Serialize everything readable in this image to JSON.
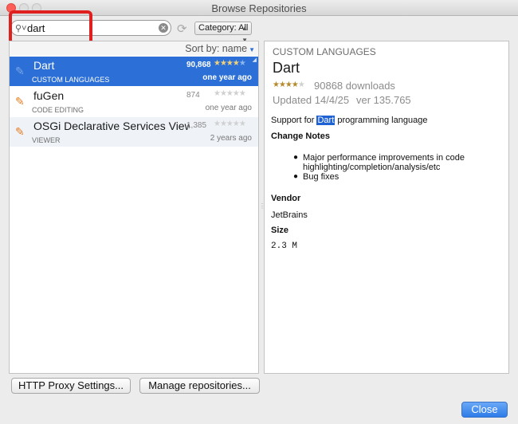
{
  "window": {
    "title": "Browse Repositories"
  },
  "search": {
    "value": "dart",
    "icon": "search-icon"
  },
  "toolbar": {
    "category_label": "Category: All"
  },
  "list": {
    "sort_label": "Sort by: name",
    "plugins": [
      {
        "name": "Dart",
        "category": "CUSTOM LANGUAGES",
        "downloads": "90,868",
        "rating": 4,
        "date": "one year ago",
        "selected": true
      },
      {
        "name": "fuGen",
        "category": "CODE EDITING",
        "downloads": "874",
        "rating": 0,
        "date": "one year ago",
        "selected": false
      },
      {
        "name": "OSGi Declarative Services Viewer",
        "category": "VIEWER",
        "downloads": "1,385",
        "rating": 0,
        "date": "2 years ago",
        "selected": false
      }
    ]
  },
  "detail": {
    "category": "CUSTOM LANGUAGES",
    "name": "Dart",
    "rating": 4,
    "downloads": "90868 downloads",
    "updated": "Updated 14/4/25",
    "version": "ver 135.765",
    "description_pre": "Support for ",
    "description_highlight": "Dart",
    "description_post": " programming language",
    "change_notes_heading": "Change Notes",
    "change_notes": [
      "Major performance improvements in code highlighting/completion/analysis/etc",
      "Bug fixes"
    ],
    "vendor_heading": "Vendor",
    "vendor": "JetBrains",
    "size_heading": "Size",
    "size": "2.3 M"
  },
  "buttons": {
    "proxy": "HTTP Proxy Settings...",
    "repositories": "Manage repositories...",
    "close": "Close"
  },
  "colors": {
    "selection": "#2c6fd6",
    "annotation": "#e01f1f"
  }
}
